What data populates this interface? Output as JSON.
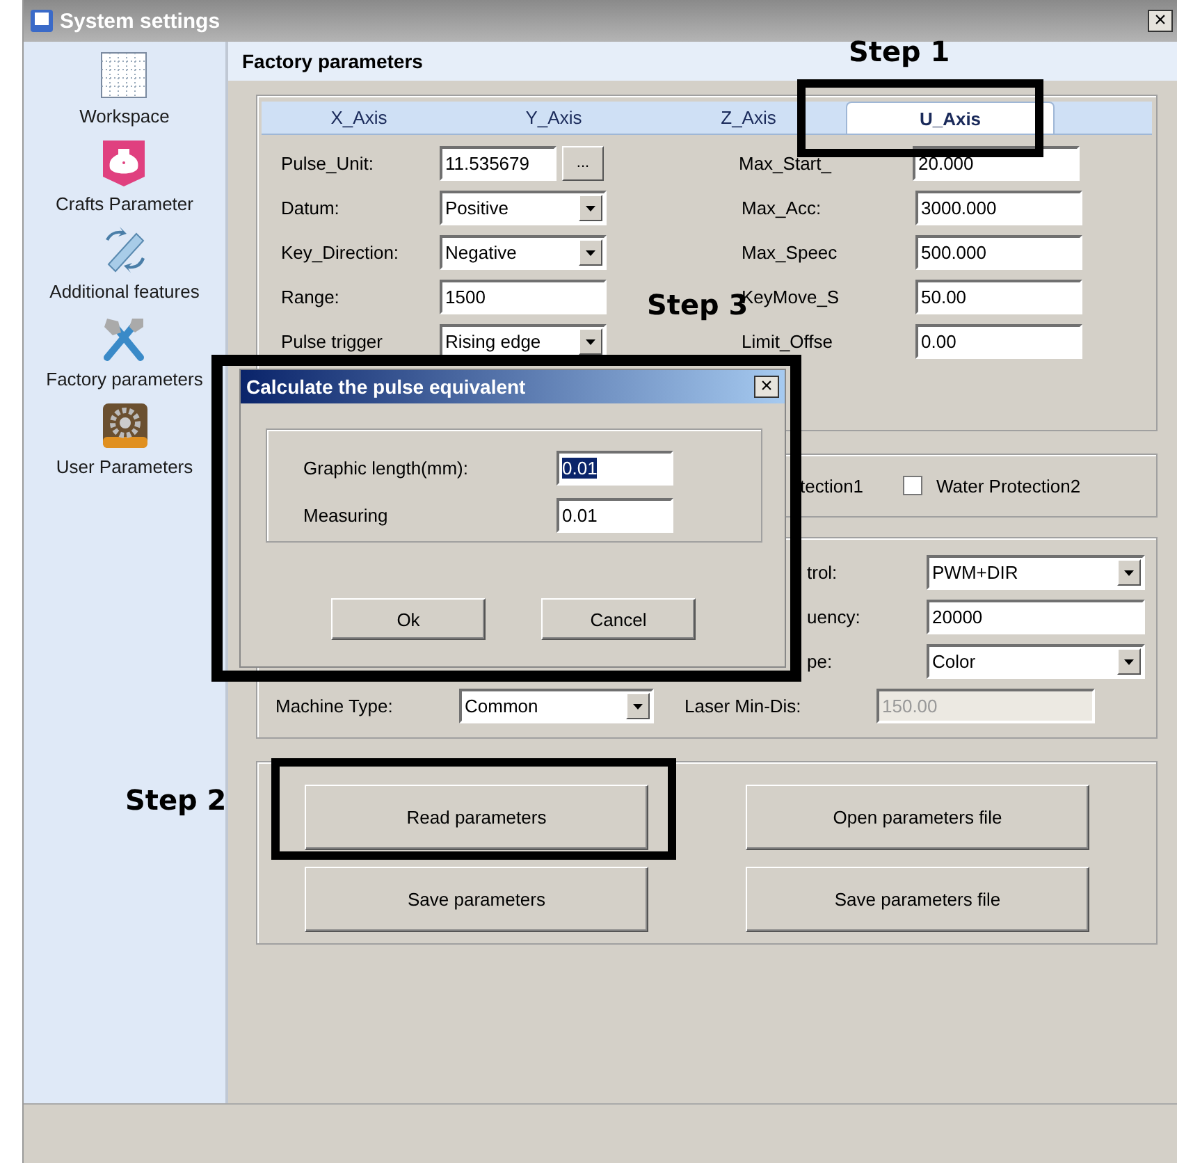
{
  "window": {
    "title": "System settings",
    "close": "×"
  },
  "sidebar": {
    "items": [
      {
        "label": "Workspace",
        "kind": "grid"
      },
      {
        "label": "Crafts Parameter",
        "kind": "jug"
      },
      {
        "label": "Additional features",
        "kind": "panel"
      },
      {
        "label": "Factory parameters",
        "kind": "tools"
      },
      {
        "label": "User Parameters",
        "kind": "gear"
      }
    ]
  },
  "header": "Factory parameters",
  "axis_tabs": [
    {
      "label": "X_Axis",
      "selected": false
    },
    {
      "label": "Y_Axis",
      "selected": false
    },
    {
      "label": "Z_Axis",
      "selected": false
    },
    {
      "label": "U_Axis",
      "selected": true
    }
  ],
  "axis_rows": [
    {
      "left": {
        "label": "Pulse_Unit:",
        "value": "11.535679",
        "kind": "browse",
        "button": "..."
      },
      "right": {
        "label": "Max_Start_",
        "value": "20.000",
        "kind": "text"
      }
    },
    {
      "left": {
        "label": "Datum:",
        "value": "Positive",
        "kind": "select"
      },
      "right": {
        "label": "Max_Acc:",
        "value": "3000.000",
        "kind": "text"
      }
    },
    {
      "left": {
        "label": "Key_Direction:",
        "value": "Negative",
        "kind": "select"
      },
      "right": {
        "label": "Max_Speec",
        "value": "500.000",
        "kind": "text"
      }
    },
    {
      "left": {
        "label": "Range:",
        "value": "1500",
        "kind": "text"
      },
      "right": {
        "label": "KeyMove_S",
        "value": "50.00",
        "kind": "text"
      }
    },
    {
      "left": {
        "label": "Pulse trigger",
        "value": "Rising edge",
        "kind": "select"
      },
      "right": {
        "label": "Limit_Offse",
        "value": "0.00",
        "kind": "text"
      }
    }
  ],
  "protection": [
    {
      "kind": "label",
      "label": "tection1"
    },
    {
      "kind": "checkbox",
      "label": "Water Protection2",
      "checked": false
    }
  ],
  "laser_rows": [
    {
      "right": {
        "label": "trol:",
        "value": "PWM+DIR",
        "kind": "select"
      }
    },
    {
      "right": {
        "label": "uency:",
        "value": "20000",
        "kind": "text"
      }
    },
    {
      "right": {
        "label": "pe:",
        "value": "Color",
        "kind": "select"
      }
    },
    {
      "left": {
        "label": "Machine Type:",
        "value": "Common",
        "kind": "select"
      },
      "right": {
        "label": "Laser Min-Dis:",
        "value": "150.00",
        "kind": "text",
        "disabled": true
      }
    }
  ],
  "buttons": [
    "Read parameters",
    "Open parameters file",
    "Save parameters",
    "Save parameters file"
  ],
  "dialog": {
    "title": "Calculate the pulse equivalent",
    "close": "×",
    "fields": [
      {
        "label": "Graphic length(mm):",
        "value": "0.01",
        "selected": true
      },
      {
        "label": "Measuring",
        "value": "0.01",
        "selected": false
      }
    ],
    "buttons": [
      "Ok",
      "Cancel"
    ]
  },
  "annotations": [
    {
      "label": "Step 1"
    },
    {
      "label": "Step 3"
    },
    {
      "label": "Step 2"
    }
  ]
}
